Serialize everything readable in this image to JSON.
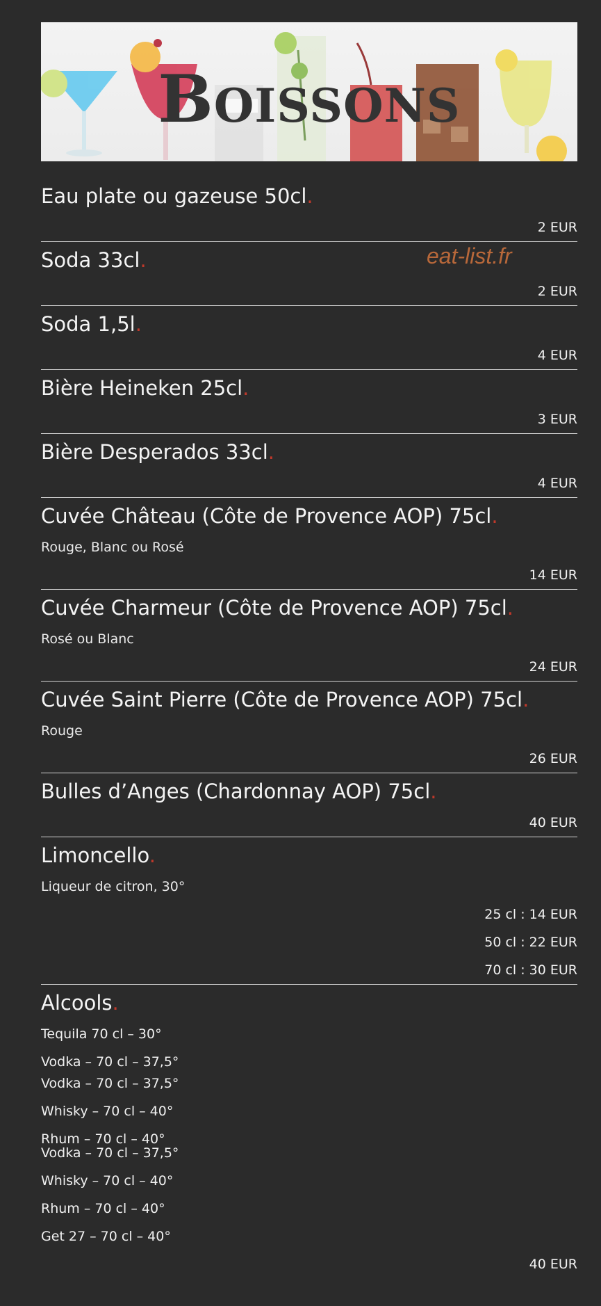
{
  "header": {
    "title": "Boissons"
  },
  "watermark": "eat-list.fr",
  "colors": {
    "background": "#2b2b2b",
    "accent_dot": "#c0392b",
    "watermark": "#b8683a"
  },
  "items": [
    {
      "name": "Eau plate ou gazeuse 50cl",
      "price": "2 EUR"
    },
    {
      "name": "Soda 33cl",
      "price": "2 EUR"
    },
    {
      "name": "Soda 1,5l",
      "price": "4 EUR"
    },
    {
      "name": "Bière Heineken 25cl",
      "price": "3 EUR"
    },
    {
      "name": "Bière Desperados 33cl",
      "price": "4 EUR"
    },
    {
      "name": "Cuvée Château (Côte de Provence AOP) 75cl",
      "desc": "Rouge, Blanc ou Rosé",
      "price": "14 EUR"
    },
    {
      "name": "Cuvée Charmeur (Côte de Provence AOP) 75cl",
      "desc": "Rosé ou Blanc",
      "price": "24 EUR"
    },
    {
      "name": "Cuvée Saint Pierre (Côte de Provence AOP) 75cl",
      "desc": "Rouge",
      "price": "26 EUR"
    },
    {
      "name": "Bulles d’Anges (Chardonnay AOP) 75cl",
      "price": "40 EUR"
    },
    {
      "name": "Limoncello",
      "desc": "Liqueur de citron, 30°",
      "prices": [
        "25 cl : 14 EUR",
        "50 cl : 22 EUR",
        "70 cl : 30 EUR"
      ]
    }
  ],
  "alcools": {
    "name": "Alcools",
    "lines": [
      "Tequila 70 cl – 30°",
      "Vodka – 70 cl – 37,5°",
      "Vodka – 70 cl – 37,5°",
      "Whisky – 70 cl – 40°",
      "Rhum – 70 cl – 40°",
      "Vodka – 70 cl – 37,5°",
      "Whisky – 70 cl – 40°",
      "Rhum – 70 cl – 40°",
      "Get 27 – 70 cl – 40°"
    ],
    "price": "40 EUR"
  }
}
